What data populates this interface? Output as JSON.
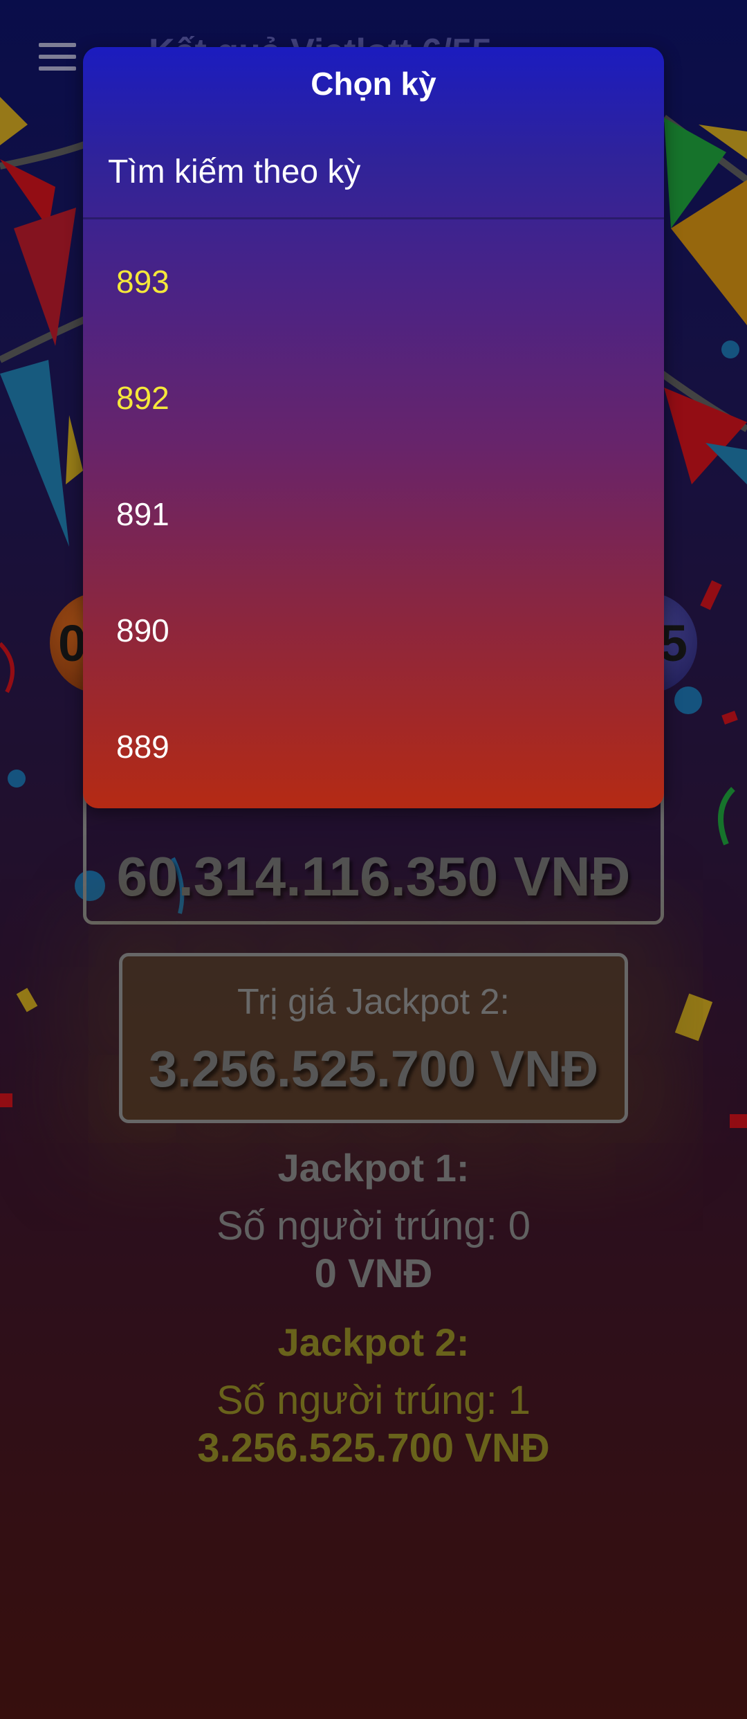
{
  "app_bar": {
    "title": "Kết quả Vietlott 6/55"
  },
  "balls": {
    "left_partial": "0",
    "right_partial": "5"
  },
  "jackpot_cards": {
    "jackpot1_value": "60.314.116.350 VNĐ",
    "jackpot2_label": "Trị giá Jackpot 2:",
    "jackpot2_value": "3.256.525.700 VNĐ"
  },
  "results": {
    "jackpot1": {
      "heading": "Jackpot 1:",
      "winners": "Số người trúng: 0",
      "amount": "0 VNĐ"
    },
    "jackpot2": {
      "heading": "Jackpot 2:",
      "winners": "Số người trúng: 1",
      "amount": "3.256.525.700 VNĐ"
    }
  },
  "dialog": {
    "title": "Chọn kỳ",
    "search_placeholder": "Tìm kiếm theo kỳ",
    "periods": [
      "893",
      "892",
      "891",
      "890",
      "889"
    ]
  },
  "colors": {
    "highlight_period": "#f5e83a",
    "dialog_top": "#1b1cbf",
    "dialog_bottom": "#b52a14",
    "jackpot2_gold": "#8c8424"
  }
}
